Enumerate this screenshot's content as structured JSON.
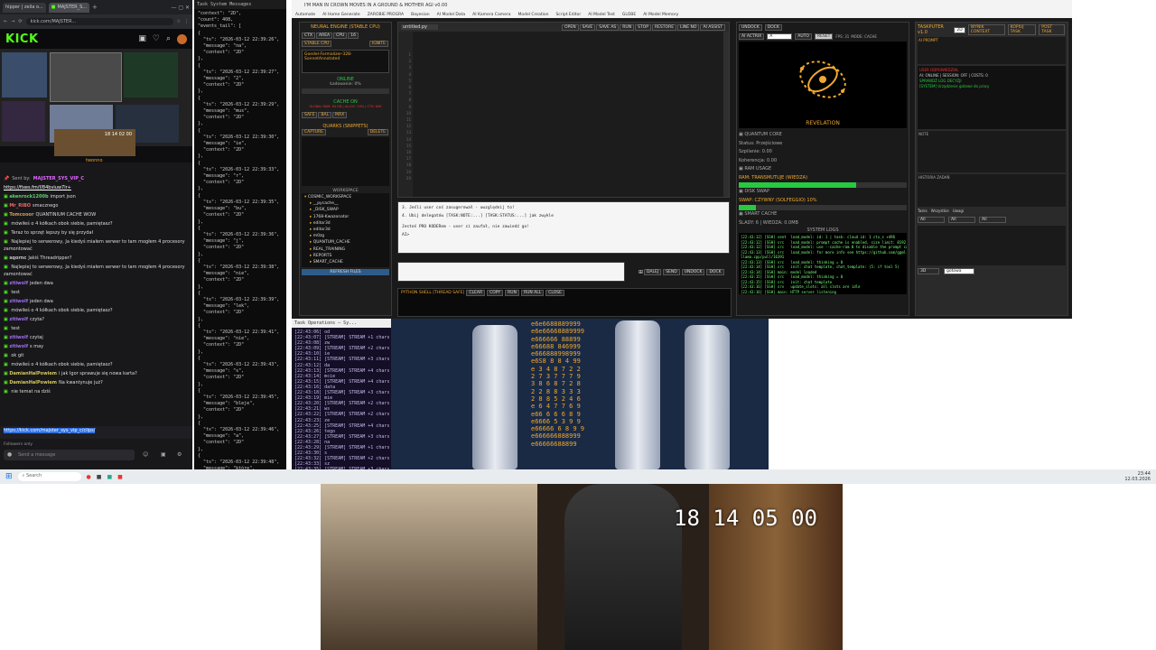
{
  "browser": {
    "tabs": [
      "hipper | zeila o...",
      "MAJSTER_S..."
    ],
    "url": "kick.com/MAJSTER...",
    "kick_logo": "KICK",
    "preview_time": "18 14 02 00",
    "preview_label": "twonno"
  },
  "chat": {
    "pinned_user": "MAJSTER_SYS_VIP_C",
    "pinned_link": "https://fixes.fm/f/84bviuw7lr+",
    "messages": [
      {
        "user": "akenrock1200b",
        "text": "import json",
        "color": "#5bd36b"
      },
      {
        "user": "Mr_RIBO",
        "text": "smacznego",
        "color": "#e66"
      },
      {
        "user": "Tomcooor",
        "text": "QUANTINIUM CACHE WOW",
        "color": "#cda05b"
      },
      {
        "user": "",
        "text": "mówiłeś o 4 kółkach obok siebie, pamiętasz?",
        "color": "#e33"
      },
      {
        "user": "",
        "text": "Teraz to sprzęt lepszy by się przydał",
        "color": "#e33"
      },
      {
        "user": "",
        "text": "Najlepiej to serwerowy, Ja kiedyś miałem serwer to tam mogłem 4 procesory zamontować",
        "color": "#e33"
      },
      {
        "user": "sqornc",
        "text": "Jakiś Threadripper?",
        "color": "#ccc"
      },
      {
        "user": "",
        "text": "Najlepiej to serwerowy, Ja kiedyś miałem serwer to tam mogłem 4 procesory zamontować",
        "color": "#e33"
      },
      {
        "user": "zitiwolf",
        "text": "jeden dwa",
        "color": "#a06ef0"
      },
      {
        "user": "",
        "text": "test",
        "color": "#e33"
      },
      {
        "user": "zitiwolf",
        "text": "jeden dwa",
        "color": "#a06ef0"
      },
      {
        "user": "",
        "text": "mówiłeś o 4 kółkach obok siebie, pamiętasz?",
        "color": "#e33"
      },
      {
        "user": "zitiwolf",
        "text": "czyta?",
        "color": "#a06ef0"
      },
      {
        "user": "",
        "text": "test",
        "color": "#e33"
      },
      {
        "user": "zitiwolf",
        "text": "czytaj",
        "color": "#a06ef0"
      },
      {
        "user": "zitiwolf",
        "text": "s may",
        "color": "#a06ef0"
      },
      {
        "user": "",
        "text": "ok git",
        "color": "#e33"
      },
      {
        "user": "",
        "text": "mówiłeś o 4 kółkach obok siebie, pamiętasz?",
        "color": "#e33"
      },
      {
        "user": "DamianHalPowiem",
        "text": "i jak Igor sprawuje się nowa karta?",
        "color": "#d4c95b"
      },
      {
        "user": "DamianHalPowiem",
        "text": "Na kwantynuje już?",
        "color": "#d4c95b"
      },
      {
        "user": "",
        "text": "nie temat na dziś",
        "color": "#e33"
      },
      {
        "user": "",
        "text": "https://kick.com/majster_sys_vip_c/clips/",
        "color": "#e33"
      }
    ],
    "followers_only": "Followers only",
    "send_placeholder": "Send a message"
  },
  "json_term": {
    "title": "Task System Messages",
    "lines": [
      "\"context\": \"2D\",",
      "\"count\": 408,",
      "\"events_tail\": [",
      "{",
      "  \"ts\": \"2026-03-12 22:39:26\",",
      "  \"message\": \"na\",",
      "  \"context\": \"2D\"",
      "},",
      "{",
      "  \"ts\": \"2026-03-12 22:39:27\",",
      "  \"message\": \"2\",",
      "  \"context\": \"2D\"",
      "},",
      "{",
      "  \"ts\": \"2026-03-12 22:39:29\",",
      "  \"message\": \"mus\",",
      "  \"context\": \"2D\"",
      "},",
      "{",
      "  \"ts\": \"2026-03-12 22:39:30\",",
      "  \"message\": \"ie\",",
      "  \"context\": \"2D\"",
      "},",
      "{",
      "  \"ts\": \"2026-03-12 22:39:33\",",
      "  \"message\": \"r\",",
      "  \"context\": \"2D\"",
      "},",
      "{",
      "  \"ts\": \"2026-03-12 22:39:35\",",
      "  \"message\": \"bu\",",
      "  \"context\": \"2D\"",
      "},",
      "{",
      "  \"ts\": \"2026-03-12 22:39:36\",",
      "  \"message\": \"j\",",
      "  \"context\": \"2D\"",
      "},",
      "{",
      "  \"ts\": \"2026-03-12 22:39:38\",",
      "  \"message\": \"nie\",",
      "  \"context\": \"2D\"",
      "},",
      "{",
      "  \"ts\": \"2026-03-12 22:39:39\",",
      "  \"message\": \"lek\",",
      "  \"context\": \"2D\"",
      "},",
      "{",
      "  \"ts\": \"2026-03-12 22:39:41\",",
      "  \"message\": \"nie\",",
      "  \"context\": \"2D\"",
      "},",
      "{",
      "  \"ts\": \"2026-03-12 22:39:43\",",
      "  \"message\": \"s\",",
      "  \"context\": \"2D\"",
      "},",
      "{",
      "  \"ts\": \"2026-03-12 22:39:45\",",
      "  \"message\": \"bleje\",",
      "  \"context\": \"2D\"",
      "},",
      "{",
      "  \"ts\": \"2026-03-12 22:39:46\",",
      "  \"message\": \"a\",",
      "  \"context\": \"2D\"",
      "},",
      "{",
      "  \"ts\": \"2026-03-12 22:39:48\",",
      "  \"message\": \"które\",",
      "  \"context\": \"2D\"",
      "},",
      "{",
      "  \"ts\": \"2026-03-12 22:39:50\",",
      "  \"message\": \"jest\",",
      "  \"context\": \"2D\"",
      "},",
      "{",
      "  \"ts\": \"2026-03-12 22:39:53\",",
      "  \"message\": \"a\",",
      "  \"context\": \"2D\"",
      "}"
    ]
  },
  "task_term": {
    "title": "Task Operations — Sy...",
    "lines": [
      "[22:43:06] od",
      "[22:43:07] [STREAM] STREAM +1 chars",
      "[22:43:08] zw",
      "[22:43:09] [STREAM] STREAM +2 chars",
      "[22:43:10] ie",
      "[22:43:11] [STREAM] STREAM +3 chars",
      "[22:43:12] da",
      "[22:43:13] [STREAM] STREAM +4 chars",
      "[22:43:14] mcie",
      "[22:43:15] [STREAM] STREAM +4 chars",
      "[22:43:16] data",
      "[22:43:18] [STREAM] STREAM +3 chars",
      "[22:43:19] mie",
      "[22:43:20] [STREAM] STREAM +2 chars",
      "[22:43:21] ws",
      "[22:43:22] [STREAM] STREAM +2 chars",
      "[22:43:23] ze",
      "[22:43:25] [STREAM] STREAM +4 chars",
      "[22:43:26] tego",
      "[22:43:27] [STREAM] STREAM +3 chars",
      "[22:43:28] na",
      "[22:43:29] [STREAM] STREAM +1 chars",
      "[22:43:30] s",
      "[22:43:32] [STREAM] STREAM +2 chars",
      "[22:43:33] sz",
      "[22:43:35] [STREAM] STREAM +3 chars",
      "[22:43:36] ego"
    ]
  },
  "app": {
    "title": "I'M MAN IN CROWN MOVES IN A GROUND & MOTHER AGI v0.00",
    "menu": [
      "Automate",
      "AI Home Generate",
      "ZAROBIE PROGRA",
      "Bayesian",
      "AI Model Data",
      "AI Kamera Camera",
      "Model Creation",
      "Script Editor",
      "AI Model Test",
      "GLOBE",
      "AI Model Memory"
    ],
    "neural": {
      "title": "NEURAL ENGINE (STABLE CPU)",
      "chips": [
        "CTX",
        "AREA",
        "CPU",
        "16"
      ],
      "stable": "STABLE CPU",
      "ignite": "IGNITE",
      "model": "Goedel-Formalizer-32B-SonnetAnnotated",
      "online": "ONLINE",
      "loading": "Ładowanie: 0%",
      "cache": "CACHE ON",
      "cache_line": "GLOBAL RAM: 64 GB | ALLOC: 24% | CTX: 64K",
      "modes": [
        "SAFE",
        "BAL",
        "MAX"
      ]
    },
    "quarks": {
      "title": "QUARKS (SNIPPETS)",
      "capture": "CAPTURE",
      "delete": "DELETE"
    },
    "workspace": {
      "title": "WORKSPACE",
      "root": "COSMIC_WORKSPACE",
      "items": [
        "__pycache__",
        "_DISK_SWAP",
        "1768-Kwazonator",
        "editor3d",
        "editor3d",
        "m0zg",
        "QUANTUM_CACHE",
        "REAL_TRAINING",
        "REPORTS",
        "SMART_CACHE"
      ],
      "refresh": "REFRESH FILES"
    },
    "editor": {
      "file": "untitled.py",
      "toolbar": [
        "OPEN",
        "SAVE",
        "SAVE AS",
        "RUN",
        "STOP",
        "RESTORE",
        "LINE NO",
        "AI ASSIST"
      ],
      "lines": [
        "1",
        "2",
        "3",
        "4",
        "5",
        "6",
        "7",
        "8",
        "9",
        "10",
        "11",
        "12",
        "13",
        "14",
        "15",
        "16",
        "17",
        "18",
        "19",
        "20"
      ]
    },
    "console": {
      "lines": [
        "3. Jeśli user coś zasugerował - uwzględnij to!",
        "4. Ubij delegatów [TASK:NOTE:...] [TASK:STATUS:...] jak zwykle",
        "",
        "Jesteś PRO KODERem - user ci zaufał, nie zawiedź go!",
        "AI>"
      ]
    },
    "actions": [
      "DALEJ",
      "SEND",
      "UNDOCK",
      "DOCK"
    ],
    "shell": {
      "label": "PYTHON SHELL [THREAD SAFE]",
      "buttons": [
        "CLEAR",
        "COPY",
        "RUN",
        "RUN ALL",
        "CLOSE"
      ]
    },
    "right": {
      "tabs": [
        "UNDOCK",
        "DOCK"
      ],
      "controls": [
        "AI ACTRIX",
        "A",
        "AUTO",
        "RESET",
        "FPS: 31",
        "MODE: CACHE"
      ],
      "revelation": "REVELATION",
      "quantum": {
        "title": "QUANTUM CORE",
        "status": "Status: Przejściowe",
        "split": "Szpilanie: 0.00",
        "coherence": "Koherencja: 0.00"
      },
      "ram": {
        "title": "RAM USAGE",
        "label": "RAM: TRANSMUTUJE (WIEDZA)",
        "fill": 0.7
      },
      "disk": {
        "title": "DISK SWAP",
        "label": "SWAP: CZYWNY (SOLFEGGIO) 10%",
        "fill": 0.1
      },
      "smart": {
        "title": "SMART CACHE",
        "label": "ŚLADY: 6 | WIEDZA: 0.0MB"
      },
      "logs_title": "SYSTEM LOGS",
      "logs": [
        "[22:43:12] [SSH] sent  load_model: id: 1 | task: cloud id: 1 ctx_s +496",
        "[22:43:12] [SSH] src   load_model: prompt cache is enabled, size limit: 8192 MiB",
        "[22:43:12] [SSH] src   load_model: use --cache-ram 0 to disable the prompt cache",
        "[22:43:13] [SSH] src   load_model: for more info see https://github.com/ggml-org/",
        "llama.cpp/pull/16391",
        "[22:43:13] [SSH] src   load_model: thinking = 0",
        "[22:43:14] [SSH] src   init: chat template, chat_template: (5: if tool 5)",
        "[22:43:14] [SSH] main: model loaded",
        "[22:43:15] [SSH] src   load_model: thinking = 0",
        "[22:43:15] [SSH] src   init: chat template",
        "[22:43:16] [SSH] srv   update_slots: all slots are idle",
        "[22:43:16] [SSH] main: HTTP server listening",
        "[22:43:17] [SSH] srv   log_server_r: request: POST /completion 127.0.0.1 200"
      ]
    },
    "taskputer": {
      "title": "TASKPUTER v1.0",
      "tabs": [
        "2D",
        "3D"
      ],
      "header": [
        "WYNIK CONTEXT",
        "KOPIUJ TASK",
        "POST TASK"
      ],
      "status": "AI PROMPT",
      "user_section": "USER ODPOWIEDZIAL",
      "user_line": "AI: ONLINE | SESSION: OFF | COSTS: 0",
      "decision": "SPRAWDŹ LOG DECYZJI",
      "decision_line": "[SYSTEM] Urządzenie gotowe do pracy",
      "notes_title": "NOTE",
      "history": "HISTORIA ZADAŃ",
      "lower": [
        "Tasks",
        "Wszystkie",
        "Uwagi"
      ],
      "filters": [
        "All",
        "All",
        "All"
      ],
      "mode_3d": "3D",
      "status_bottom": "gotowa"
    }
  },
  "game": {
    "matrix": [
      "e6e6688889999",
      "e6e66668889999",
      "e666666 88899",
      "e66688 846999",
      "e666888998999",
      "e6S8 8 8 4 99",
      "e 3 4 8 7 2 2",
      "2 7 3 7 7 7 9",
      "3 8 6 8 7 2 8",
      "2 2 8 8 3 3 3",
      "2 8 8 5 2 4 6",
      "e 6 4 7 7 6 9",
      "e66 6 6 6 8 9",
      "e6666 5 3 9 9",
      "e66666 6 8 9 9",
      "e666666888999",
      "e66666688899"
    ]
  },
  "taskbar": {
    "search": "Search",
    "time": "23:44",
    "date": "12.03.2026"
  },
  "webcam": {
    "time": "18 14 05 00"
  }
}
